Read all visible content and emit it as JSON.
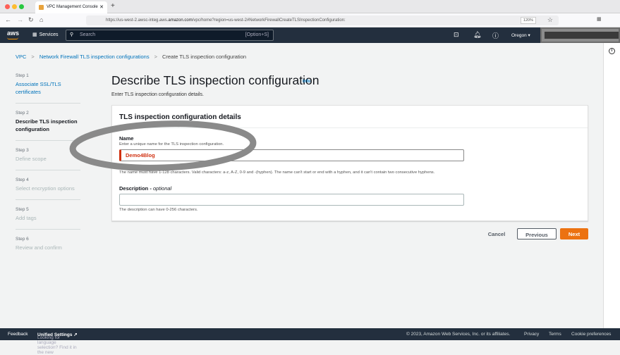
{
  "browser": {
    "tab_title": "VPC Management Console",
    "url_prefix": "https://us-west-2.awsc-integ.aws.",
    "url_domain": "amazon.com",
    "url_rest": "/vpc/home?region=us-west-2#NetworkFirewallCreateTLSInspectionConfiguration:",
    "zoom": "120%"
  },
  "nav": {
    "logo": "aws",
    "services": "Services",
    "search_placeholder": "Search",
    "shortcut": "[Option+S]",
    "region": "Oregon ▾"
  },
  "breadcrumb": [
    "VPC",
    "Network Firewall TLS inspection configurations",
    "Create TLS inspection configuration"
  ],
  "steps": [
    {
      "n": "Step 1",
      "l": "Associate SSL/TLS certificates"
    },
    {
      "n": "Step 2",
      "l": "Describe TLS inspection configuration"
    },
    {
      "n": "Step 3",
      "l": "Define scope"
    },
    {
      "n": "Step 4",
      "l": "Select encryption options"
    },
    {
      "n": "Step 5",
      "l": "Add tags"
    },
    {
      "n": "Step 6",
      "l": "Review and confirm"
    }
  ],
  "page": {
    "title": "Describe TLS inspection configuration",
    "info": "Info",
    "subtitle": "Enter TLS inspection configuration details."
  },
  "panel": {
    "title": "TLS inspection configuration details",
    "name_label": "Name",
    "name_hint": "Enter a unique name for the TLS inspection configuration.",
    "name_value": "Demo4Blog",
    "name_constraint": "The name must have 1-128 characters. Valid characters: a-z, A-Z, 0-9 and -(hyphen). The name can't start or end with a hyphen, and it can't contain two consecutive hyphens.",
    "desc_label": "Description - ",
    "desc_optional": "optional",
    "desc_value": "",
    "desc_constraint": "The description can have 0-256 characters."
  },
  "buttons": {
    "cancel": "Cancel",
    "previous": "Previous",
    "next": "Next"
  },
  "footer": {
    "feedback": "Feedback",
    "lang": "Looking for language selection? Find it in the new ",
    "unified": "Unified Settings ↗",
    "copyright": "© 2023, Amazon Web Services, Inc. or its affiliates.",
    "privacy": "Privacy",
    "terms": "Terms",
    "cookies": "Cookie preferences"
  },
  "colors": {
    "accent": "#ec7211",
    "link": "#0073bb",
    "error": "#d13212",
    "nav": "#232f3e"
  }
}
